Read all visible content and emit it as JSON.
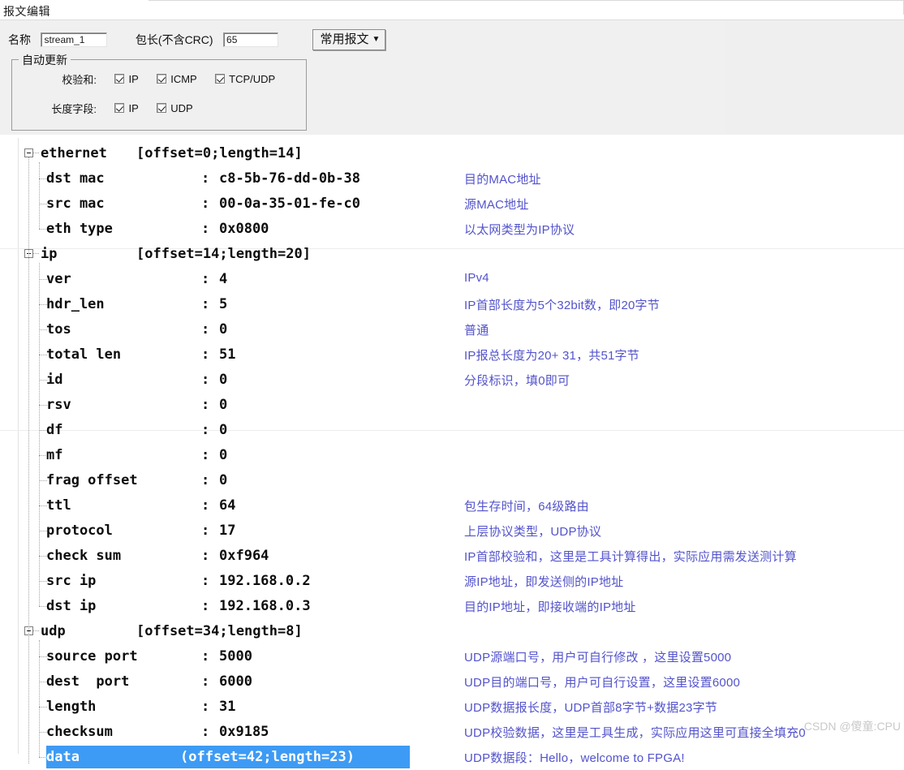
{
  "window": {
    "title": "报文编辑"
  },
  "form": {
    "name_label": "名称",
    "name_value": "stream_1",
    "name_placeholder": "stream_1",
    "pklen_label": "包长(不含CRC)",
    "pklen_value": "65",
    "pklen_placeholder": "65",
    "preset_button": "常用报文",
    "preset_caret": "▼",
    "group_legend": "自动更新",
    "checksum_label": "校验和:",
    "checksum_items": [
      "IP",
      "ICMP",
      "TCP/UDP"
    ],
    "lenfield_label": "长度字段:",
    "lenfield_items": [
      "IP",
      "UDP"
    ]
  },
  "tree": [
    {
      "level": 0,
      "name": "ethernet",
      "range": "[offset=0;length=14]",
      "annotation": ""
    },
    {
      "level": 1,
      "name": "dst mac",
      "value": "c8-5b-76-dd-0b-38",
      "annotation": "目的MAC地址"
    },
    {
      "level": 1,
      "name": "src mac",
      "value": "00-0a-35-01-fe-c0",
      "annotation": "源MAC地址"
    },
    {
      "level": 1,
      "name": "eth type",
      "value": "0x0800",
      "annotation": "以太网类型为IP协议"
    },
    {
      "level": 0,
      "name": "ip",
      "range": "[offset=14;length=20]",
      "annotation": ""
    },
    {
      "level": 1,
      "name": "ver",
      "value": "4",
      "annotation": "IPv4"
    },
    {
      "level": 1,
      "name": "hdr_len",
      "value": "5",
      "annotation": "IP首部长度为5个32bit数，即20字节"
    },
    {
      "level": 1,
      "name": "tos",
      "value": "0",
      "annotation": "普通"
    },
    {
      "level": 1,
      "name": "total len",
      "value": "51",
      "annotation": "IP报总长度为20+ 31，共51字节"
    },
    {
      "level": 1,
      "name": "id",
      "value": "0",
      "annotation": "分段标识，填0即可"
    },
    {
      "level": 1,
      "name": "rsv",
      "value": "0",
      "annotation": ""
    },
    {
      "level": 1,
      "name": "df",
      "value": "0",
      "annotation": ""
    },
    {
      "level": 1,
      "name": "mf",
      "value": "0",
      "annotation": ""
    },
    {
      "level": 1,
      "name": "frag offset",
      "value": "0",
      "annotation": ""
    },
    {
      "level": 1,
      "name": "ttl",
      "value": "64",
      "annotation": "包生存时间，64级路由"
    },
    {
      "level": 1,
      "name": "protocol",
      "value": "17",
      "annotation": " 上层协议类型，UDP协议"
    },
    {
      "level": 1,
      "name": "check sum",
      "value": "0xf964",
      "annotation": "IP首部校验和，这里是工具计算得出，实际应用需发送测计算"
    },
    {
      "level": 1,
      "name": "src ip",
      "value": "192.168.0.2",
      "annotation": "源IP地址，即发送侧的IP地址"
    },
    {
      "level": 1,
      "name": "dst ip",
      "value": "192.168.0.3",
      "annotation": "目的IP地址，即接收端的IP地址"
    },
    {
      "level": 0,
      "name": "udp",
      "range": "[offset=34;length=8]",
      "annotation": ""
    },
    {
      "level": 1,
      "name": "source port",
      "value": "5000",
      "annotation": "UDP源端口号，用户可自行修改 ，这里设置5000"
    },
    {
      "level": 1,
      "name": "dest  port",
      "value": "6000",
      "annotation": "UDP目的端口号，用户可自行设置，这里设置6000"
    },
    {
      "level": 1,
      "name": "length",
      "value": "31",
      "annotation": "UDP数据报长度，UDP首部8字节+数据23字节"
    },
    {
      "level": 1,
      "name": "checksum",
      "value": "0x9185",
      "annotation": "UDP校验数据，这里是工具生成，实际应用这里可直接全填充0"
    },
    {
      "level": 1,
      "name": "data",
      "range": "(offset=42;length=23)",
      "selected": true,
      "annotation": "UDP数据段：Hello，welcome to FPGA!"
    }
  ],
  "watermark": "CSDN @傻童:CPU",
  "colors": {
    "annotation": "#5353cc",
    "selection": "#3d9bf5",
    "panel_bg": "#efefef",
    "tree_bg": "#ffffff"
  }
}
